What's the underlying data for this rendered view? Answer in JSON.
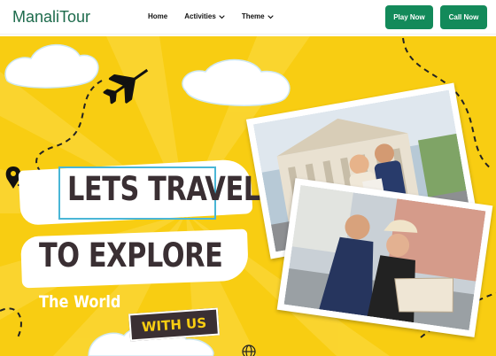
{
  "nav": {
    "brand": "ManaliTour",
    "menu": [
      {
        "label": "Home"
      },
      {
        "label": "Activities"
      },
      {
        "label": "Theme"
      }
    ],
    "play_label": "Play Now",
    "call_label": "Call Now",
    "accent": "#138a5a"
  },
  "hero": {
    "line1": "LETS TRAVEL",
    "line2": "TO EXPLORE",
    "line3": "The World",
    "badge": "WITH US",
    "background": "#f8cd12"
  },
  "icons": [
    "airplane-icon",
    "map-pin-icon",
    "globe-icon",
    "chevron-down-icon"
  ]
}
